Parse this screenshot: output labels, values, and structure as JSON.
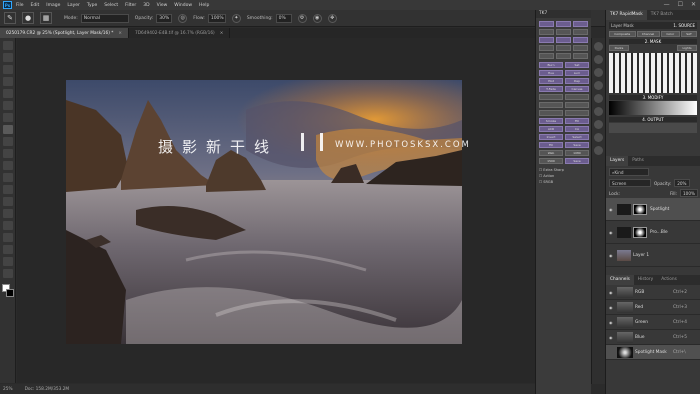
{
  "menu": [
    "File",
    "Edit",
    "Image",
    "Layer",
    "Type",
    "Select",
    "Filter",
    "3D",
    "View",
    "Window",
    "Help"
  ],
  "window_controls": [
    "—",
    "☐",
    "✕"
  ],
  "options_bar": {
    "mode_label": "Mode:",
    "mode_value": "Normal",
    "opacity_label": "Opacity:",
    "opacity_value": "30%",
    "flow_label": "Flow:",
    "flow_value": "100%",
    "smoothing_label": "Smoothing:",
    "smoothing_value": "0%"
  },
  "tabs": [
    {
      "label": "0250179.CR2 @ 25% (Spotlight, Layer Mask/16) *",
      "close": "×"
    },
    {
      "label": "7D649402-E4B.tif @ 16.7% (RGB/16)",
      "close": "×"
    }
  ],
  "watermark": "摄影新干线",
  "watermark_url": "WWW.PHOTOSKSX.COM",
  "status": {
    "zoom": "25%",
    "doc": "Doc: 158.2M/353.2M"
  },
  "rapidmask": {
    "title": "TK7 RapidMask",
    "batch_tab": "TK7 Batch",
    "header_strip": "TK7",
    "layer_mask_label": "Layer Mask",
    "source_label": "1. SOURCE",
    "sources": [
      "Composite",
      "Channel",
      "Color",
      "SAT"
    ],
    "mask_label": "2. MASK",
    "mask_options": [
      "Darks",
      "Lights"
    ],
    "modify_label": "3. MODIFY",
    "output_label": "4. OUTPUT",
    "cells": [
      "Burn",
      "Sat",
      "Hue",
      "Lum",
      "Hist",
      "Dep",
      "T-Fade",
      "Canvas",
      "Smoke",
      "Fill",
      "ACR",
      "CA",
      "Invert",
      "Select",
      "Fill",
      "Save",
      "Web",
      "1080",
      "1500",
      "Save"
    ],
    "checkbox_labels": [
      "Extra Sharp",
      "Action",
      "SRGB"
    ]
  },
  "layers_panel": {
    "tabs": [
      "Layers",
      "Paths"
    ],
    "kind_filter": "Kind",
    "blend_mode": "Screen",
    "opacity_label": "Opacity:",
    "opacity_value": "20%",
    "fill_label": "Fill:",
    "fill_value": "100%",
    "lock_label": "Lock:",
    "layers": [
      {
        "name": "Spotlight",
        "selected": true
      },
      {
        "name": "Pro...Ble",
        "selected": false
      },
      {
        "name": "Layer 1",
        "selected": false
      }
    ]
  },
  "channels_panel": {
    "tabs": [
      "Channels",
      "History",
      "Actions"
    ],
    "channels": [
      {
        "name": "RGB",
        "key": "Ctrl+2"
      },
      {
        "name": "Red",
        "key": "Ctrl+3"
      },
      {
        "name": "Green",
        "key": "Ctrl+4"
      },
      {
        "name": "Blue",
        "key": "Ctrl+5"
      },
      {
        "name": "Spotlight Mask",
        "key": "Ctrl+\\"
      }
    ]
  }
}
